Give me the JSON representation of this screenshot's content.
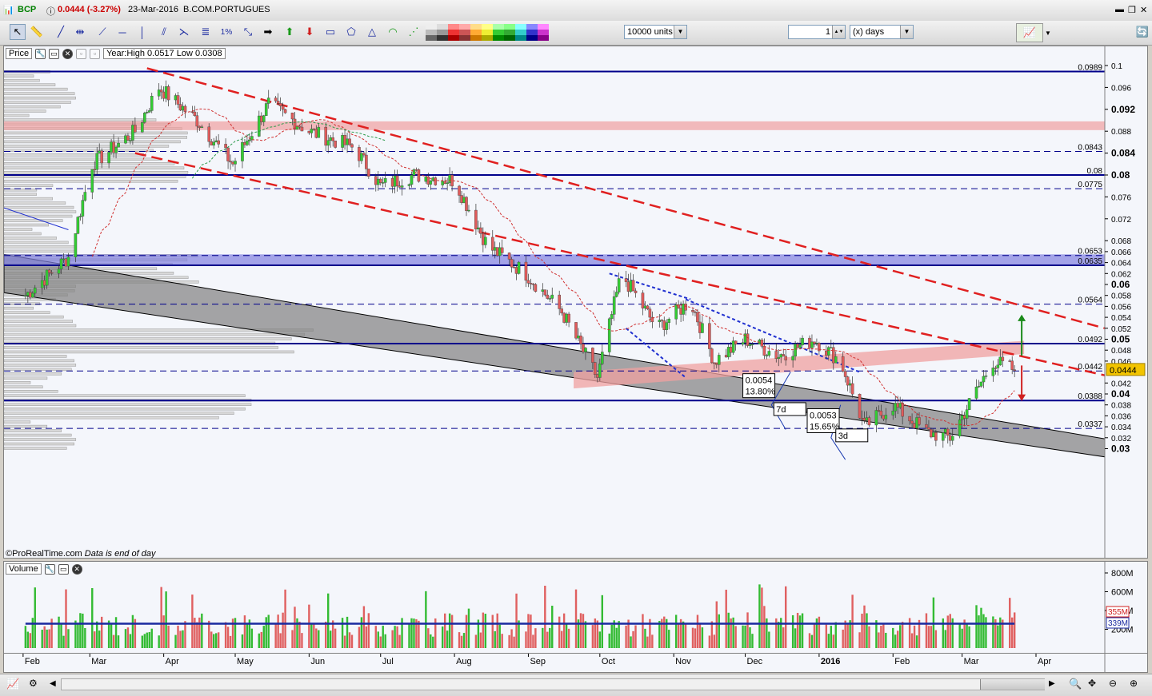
{
  "titlebar": {
    "symbol": "BCP",
    "price": "0.0444 (-3.27%)",
    "date": "23-Mar-2016",
    "name": "B.COM.PORTUGUES"
  },
  "toolbar": {
    "units": "10000 units",
    "interval_value": "1",
    "interval_unit": "(x) days"
  },
  "price_panel": {
    "label": "Price",
    "year_range": "Year:High 0.0517 Low 0.0308",
    "copyright": "©ProRealTime.com",
    "eod_note": "Data is end of day",
    "level_labels": [
      "0.0989",
      "0.0843",
      "0.08",
      "0.0775",
      "0.0653",
      "0.0635",
      "0.0564",
      "0.0492",
      "0.0442",
      "0.0388",
      "0.0337"
    ],
    "y_ticks": [
      "0.1",
      "0.096",
      "0.092",
      "0.088",
      "0.084",
      "0.08",
      "0.076",
      "0.072",
      "0.068",
      "0.066",
      "0.064",
      "0.062",
      "0.06",
      "0.058",
      "0.056",
      "0.054",
      "0.052",
      "0.05",
      "0.048",
      "0.046",
      "0.042",
      "0.04",
      "0.038",
      "0.036",
      "0.034",
      "0.032",
      "0.03"
    ],
    "current_price_tag": "0.0444",
    "annotations": {
      "box1_value": "0.0054",
      "box1_pct": "13.80%",
      "box1_days": "7d",
      "box2_value": "0.0053",
      "box2_pct": "15.65%",
      "box2_days": "3d"
    }
  },
  "volume_panel": {
    "label": "Volume",
    "y_ticks": [
      "800M",
      "600M",
      "400M",
      "200M"
    ],
    "tag_vol": "355M",
    "tag_avg": "339M"
  },
  "x_axis": {
    "labels": [
      "Feb",
      "Mar",
      "Apr",
      "May",
      "Jun",
      "Jul",
      "Aug",
      "Sep",
      "Oct",
      "Nov",
      "Dec",
      "2016",
      "Feb",
      "Mar",
      "Apr"
    ]
  },
  "colors": {
    "up_candle": "#33cc33",
    "down_candle": "#e05b5b",
    "support_line": "#00008b",
    "trend_red": "#e02020",
    "channel_grey": "#808080",
    "band_red": "#f0a0a0",
    "band_blue": "#8080e0",
    "avg_volume": "#1a2aa0"
  },
  "chart_data": {
    "type": "candlestick",
    "title": "BCP",
    "x_range": [
      "2015-02",
      "2016-04"
    ],
    "ylim": [
      0.028,
      0.102
    ],
    "horizontal_levels": [
      0.0989,
      0.0843,
      0.08,
      0.0775,
      0.0653,
      0.0635,
      0.0564,
      0.0492,
      0.0442,
      0.0388,
      0.0337
    ],
    "year_high": 0.0517,
    "year_low": 0.0308,
    "last_close": 0.0444,
    "last_change_pct": -3.27,
    "close_path": [
      {
        "x": "2015-02-02",
        "y": 0.058
      },
      {
        "x": "2015-02-20",
        "y": 0.065
      },
      {
        "x": "2015-03-02",
        "y": 0.082
      },
      {
        "x": "2015-03-20",
        "y": 0.088
      },
      {
        "x": "2015-03-30",
        "y": 0.096
      },
      {
        "x": "2015-04-15",
        "y": 0.09
      },
      {
        "x": "2015-04-30",
        "y": 0.082
      },
      {
        "x": "2015-05-15",
        "y": 0.093
      },
      {
        "x": "2015-06-01",
        "y": 0.088
      },
      {
        "x": "2015-06-20",
        "y": 0.085
      },
      {
        "x": "2015-07-01",
        "y": 0.078
      },
      {
        "x": "2015-07-15",
        "y": 0.08
      },
      {
        "x": "2015-08-01",
        "y": 0.079
      },
      {
        "x": "2015-08-15",
        "y": 0.067
      },
      {
        "x": "2015-08-31",
        "y": 0.062
      },
      {
        "x": "2015-09-15",
        "y": 0.055
      },
      {
        "x": "2015-09-30",
        "y": 0.043
      },
      {
        "x": "2015-10-10",
        "y": 0.062
      },
      {
        "x": "2015-10-25",
        "y": 0.052
      },
      {
        "x": "2015-11-08",
        "y": 0.057
      },
      {
        "x": "2015-11-18",
        "y": 0.046
      },
      {
        "x": "2015-12-01",
        "y": 0.05
      },
      {
        "x": "2015-12-15",
        "y": 0.047
      },
      {
        "x": "2015-12-30",
        "y": 0.05
      },
      {
        "x": "2016-01-10",
        "y": 0.046
      },
      {
        "x": "2016-01-20",
        "y": 0.034
      },
      {
        "x": "2016-02-01",
        "y": 0.038
      },
      {
        "x": "2016-02-15",
        "y": 0.033
      },
      {
        "x": "2016-02-25",
        "y": 0.032
      },
      {
        "x": "2016-03-05",
        "y": 0.039
      },
      {
        "x": "2016-03-14",
        "y": 0.046
      },
      {
        "x": "2016-03-23",
        "y": 0.0444
      }
    ],
    "volume_average_last": "339M",
    "volume_last": "355M",
    "legend": "none",
    "grid": true
  }
}
